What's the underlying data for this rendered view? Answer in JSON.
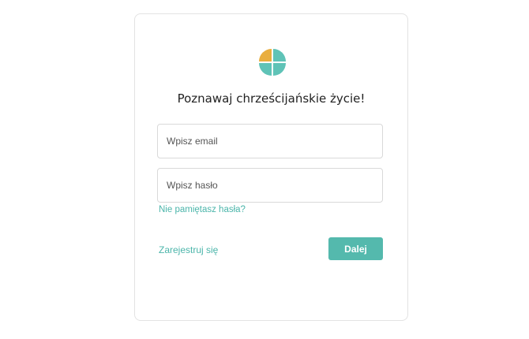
{
  "login": {
    "title": "Poznawaj chrześcijańskie życie!",
    "email_placeholder": "Wpisz email",
    "password_placeholder": "Wpisz hasło",
    "forgot_label": "Nie pamiętasz hasła?",
    "register_label": "Zarejestruj się",
    "next_label": "Dalej"
  },
  "icons": {
    "logo": "four-petal-logo-icon"
  },
  "colors": {
    "accent": "#54b9ad",
    "link": "#4bb5aa",
    "logo_orange": "#e9ae3f",
    "logo_teal": "#5fc3b7",
    "card_border": "#e3e3e3"
  }
}
